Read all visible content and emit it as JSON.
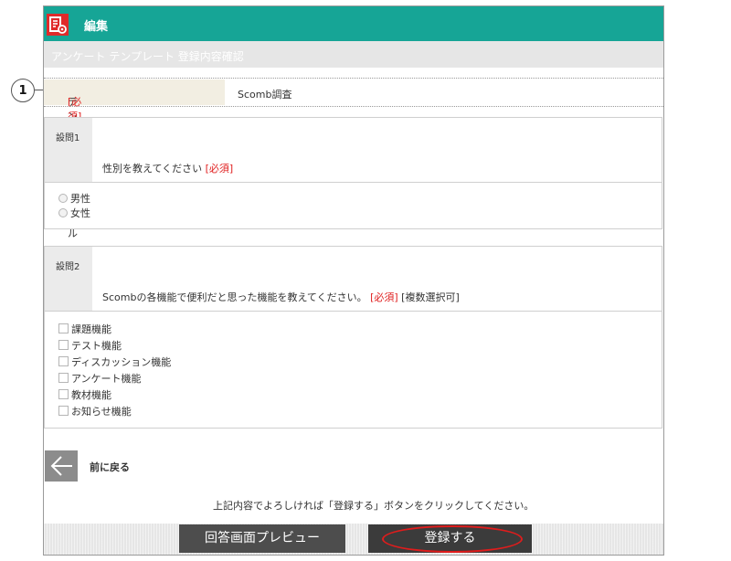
{
  "header": {
    "title": "編集"
  },
  "subheader": {
    "title": "アンケート テンプレート 登録内容確認"
  },
  "title_field": {
    "label": "テンプレートタイトル",
    "required": "[必須]",
    "value": "Scomb調査"
  },
  "questions": [
    {
      "label": "設問1",
      "text": "性別を教えてください",
      "required": "[必須]",
      "note": "",
      "type": "radio",
      "options": [
        "男性",
        "女性"
      ]
    },
    {
      "label": "設問2",
      "text": "Scombの各機能で便利だと思った機能を教えてください。",
      "required": "[必須]",
      "note": "[複数選択可]",
      "type": "checkbox",
      "options": [
        "課題機能",
        "テスト機能",
        "ディスカッション機能",
        "アンケート機能",
        "教材機能",
        "お知らせ機能"
      ]
    }
  ],
  "back": {
    "label": "前に戻る"
  },
  "confirm_note": "上記内容でよろしければ「登録する」ボタンをクリックしてください。",
  "buttons": {
    "preview": "回答画面プレビュー",
    "register": "登録する"
  },
  "callout": {
    "number": "1"
  },
  "colors": {
    "header": "#16a596",
    "required": "#e02020",
    "highlight": "#e01c1c"
  }
}
